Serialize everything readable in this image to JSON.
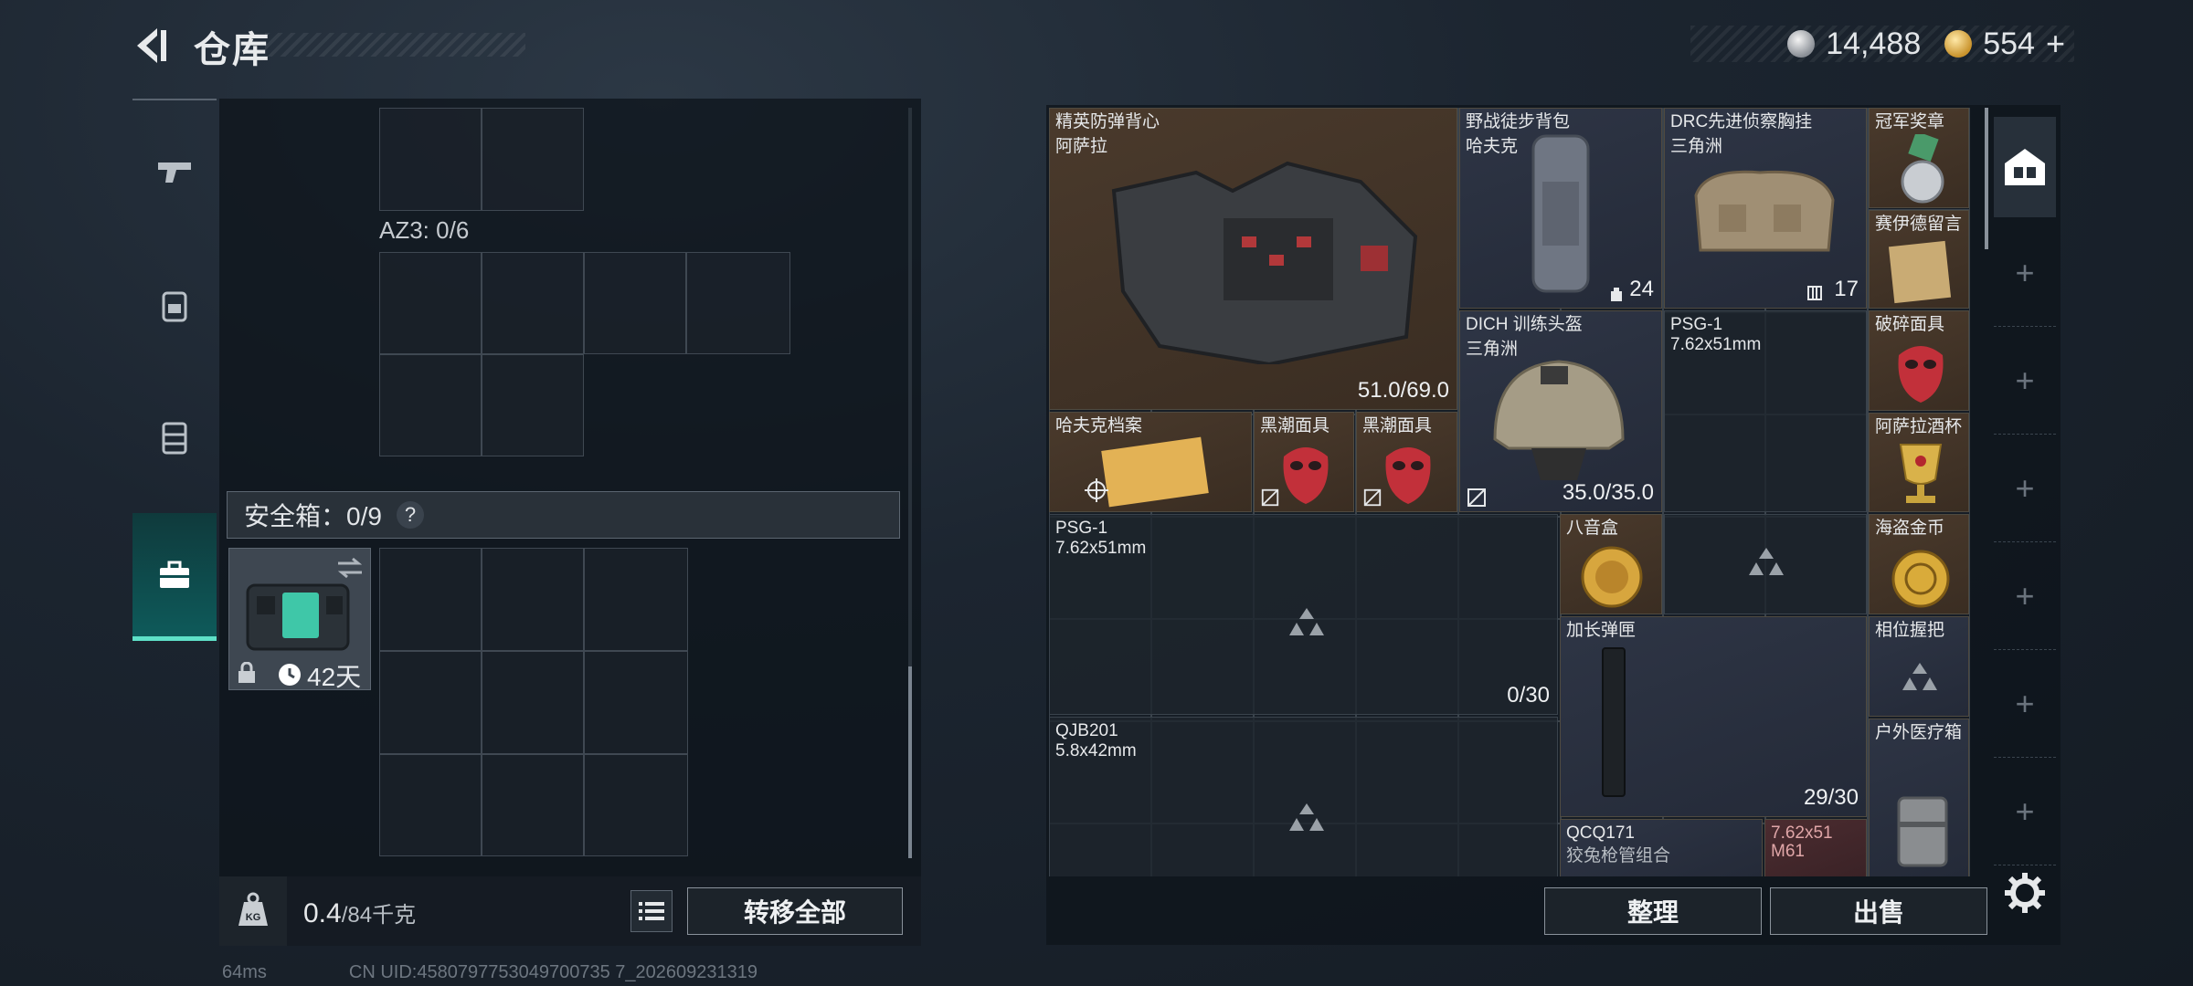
{
  "header": {
    "title": "仓库",
    "silver": "14,488",
    "gold": "554",
    "plus": "+"
  },
  "left": {
    "az3_label": "AZ3: 0/6",
    "safe_label": "安全箱：0/9",
    "safe_help": "?",
    "safe_days": "42天",
    "weight_current": "0.4",
    "weight_max": "/84千克",
    "transfer_all": "转移全部"
  },
  "status": {
    "ping": "64ms",
    "uid": "CN UID:4580797753049700735 7_202609231319"
  },
  "stash": {
    "items": [
      {
        "id": "vest",
        "name": "精英防弹背心",
        "sub": "阿萨拉",
        "value": "51.0/69.0",
        "color": "brown"
      },
      {
        "id": "backpack",
        "name": "野战徒步背包",
        "sub": "哈夫克",
        "value": "24",
        "color": "blue"
      },
      {
        "id": "chestrig",
        "name": "DRC先进侦察胸挂",
        "sub": "三角洲",
        "value": "17",
        "color": "blue"
      },
      {
        "id": "medal",
        "name": "冠军奖章",
        "sub": "",
        "value": "",
        "color": "brown"
      },
      {
        "id": "note",
        "name": "赛伊德留言",
        "sub": "",
        "value": "",
        "color": "brown"
      },
      {
        "id": "helmet",
        "name": "DICH 训练头盔",
        "sub": "三角洲",
        "value": "35.0/35.0",
        "color": "blue"
      },
      {
        "id": "psg-top",
        "name": "PSG-1",
        "sub": "7.62x51mm",
        "value": "",
        "color": "dark"
      },
      {
        "id": "broken-mask",
        "name": "破碎面具",
        "sub": "",
        "value": "",
        "color": "brown"
      },
      {
        "id": "file",
        "name": "哈夫克档案",
        "sub": "",
        "value": "",
        "color": "brown"
      },
      {
        "id": "mask1",
        "name": "黑潮面具",
        "sub": "",
        "value": "",
        "color": "brown"
      },
      {
        "id": "mask2",
        "name": "黑潮面具",
        "sub": "",
        "value": "",
        "color": "brown"
      },
      {
        "id": "cup",
        "name": "阿萨拉酒杯",
        "sub": "",
        "value": "",
        "color": "brown"
      },
      {
        "id": "psg-left",
        "name": "PSG-1",
        "sub": "7.62x51mm",
        "value": "0/30",
        "color": "dark"
      },
      {
        "id": "musicbox",
        "name": "八音盒",
        "sub": "",
        "value": "",
        "color": "brown"
      },
      {
        "id": "pirate-coin",
        "name": "海盗金币",
        "sub": "",
        "value": "",
        "color": "brown"
      },
      {
        "id": "ext-mag",
        "name": "加长弹匣",
        "sub": "",
        "value": "29/30",
        "color": "blue"
      },
      {
        "id": "grip",
        "name": "相位握把",
        "sub": "",
        "value": "",
        "color": "blue"
      },
      {
        "id": "qjb",
        "name": "QJB201",
        "sub": "5.8x42mm",
        "value": "",
        "color": "dark"
      },
      {
        "id": "medkit",
        "name": "户外医疗箱",
        "sub": "",
        "value": "",
        "color": "blue"
      },
      {
        "id": "qcq",
        "name": "QCQ171",
        "sub": "狡兔枪管组合",
        "value": "",
        "color": "blue"
      },
      {
        "id": "ammo",
        "name": "7.62x51",
        "sub": "M61",
        "value": "",
        "color": "red"
      }
    ]
  },
  "buttons": {
    "sort": "整理",
    "sell": "出售"
  }
}
